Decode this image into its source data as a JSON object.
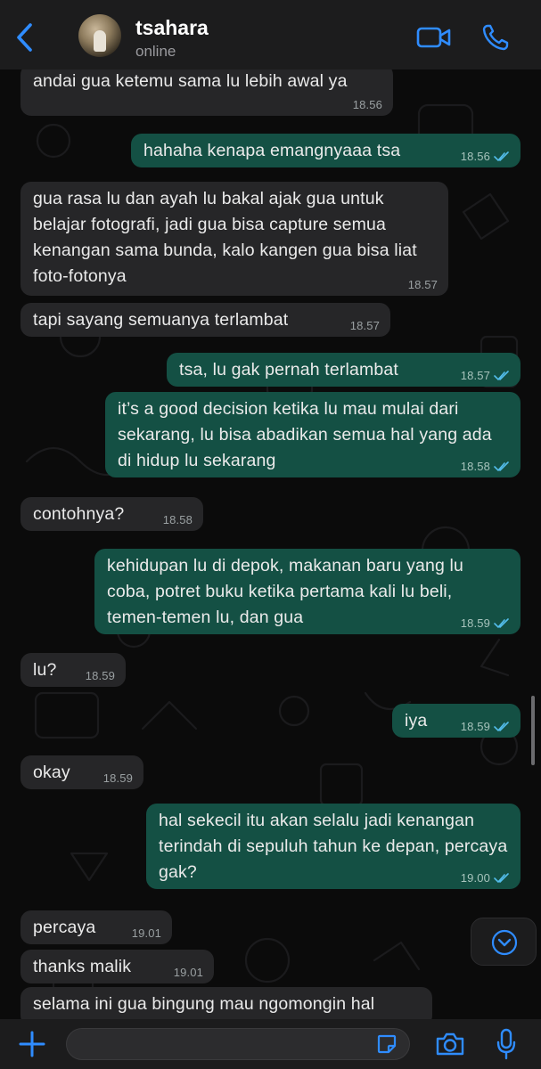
{
  "header": {
    "contact_name": "tsahara",
    "status": "online"
  },
  "messages": [
    {
      "dir": "in",
      "text": "andai gua ketemu sama lu lebih awal ya",
      "time": "18.56"
    },
    {
      "dir": "out",
      "text": "hahaha kenapa emangnyaaa tsa",
      "time": "18.56"
    },
    {
      "dir": "in",
      "text": "gua rasa lu dan ayah lu bakal ajak gua untuk belajar fotografi, jadi gua bisa capture semua kenangan sama bunda, kalo kangen gua bisa liat foto-fotonya",
      "time": "18.57"
    },
    {
      "dir": "in",
      "text": "tapi sayang semuanya terlambat",
      "time": "18.57"
    },
    {
      "dir": "out",
      "text": "tsa, lu gak pernah terlambat",
      "time": "18.57"
    },
    {
      "dir": "out",
      "text": "it’s a good decision ketika lu mau mulai dari sekarang, lu bisa abadikan semua hal yang ada di hidup lu sekarang",
      "time": "18.58"
    },
    {
      "dir": "in",
      "text": "contohnya?",
      "time": "18.58"
    },
    {
      "dir": "out",
      "text": "kehidupan lu di depok, makanan baru yang lu coba, potret buku ketika pertama kali lu beli, temen-temen lu, dan gua",
      "time": "18.59"
    },
    {
      "dir": "in",
      "text": "lu?",
      "time": "18.59"
    },
    {
      "dir": "out",
      "text": "iya",
      "time": "18.59"
    },
    {
      "dir": "in",
      "text": "okay",
      "time": "18.59"
    },
    {
      "dir": "out",
      "text": "hal sekecil itu akan selalu jadi kenangan terindah di sepuluh tahun ke depan, percaya gak?",
      "time": "19.00"
    },
    {
      "dir": "in",
      "text": "percaya",
      "time": "19.01"
    },
    {
      "dir": "in",
      "text": "thanks malik",
      "time": "19.01"
    },
    {
      "dir": "in",
      "text": "selama ini gua bingung mau ngomongin hal",
      "time": ""
    }
  ],
  "composer": {
    "value": ""
  },
  "icons": {
    "back": "chevron-left-icon",
    "video": "video-camera-icon",
    "call": "phone-icon",
    "attach": "plus-icon",
    "sticker": "sticker-icon",
    "camera": "camera-icon",
    "mic": "microphone-icon",
    "scroll_down": "chevron-down-icon"
  },
  "colors": {
    "accent": "#2f8cff",
    "outgoing_bubble": "#145044",
    "incoming_bubble": "#262628",
    "read_ticks": "#53bdeb"
  }
}
